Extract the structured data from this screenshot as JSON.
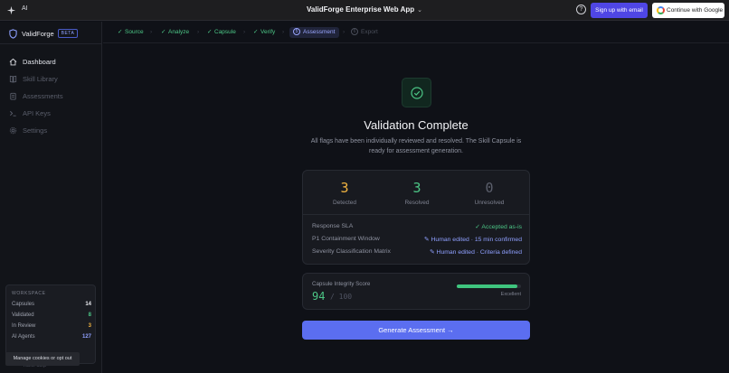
{
  "topbar": {
    "ai_label": "AI",
    "title": "ValidForge Enterprise Web App",
    "title_chevron": "⌄",
    "help_icon": "?",
    "signup_label": "Sign up with email",
    "google_label": "Continue with Google"
  },
  "sidebar": {
    "brand": "ValidForge",
    "badge": "BETA",
    "nav": [
      {
        "label": "Dashboard",
        "icon": "home-icon"
      },
      {
        "label": "Skill Library",
        "icon": "book-icon"
      },
      {
        "label": "Assessments",
        "icon": "clipboard-icon"
      },
      {
        "label": "API Keys",
        "icon": "terminal-icon"
      },
      {
        "label": "Settings",
        "icon": "gear-icon"
      }
    ],
    "workspace": {
      "title": "WORKSPACE",
      "rows": [
        {
          "label": "Capsules",
          "value": "14",
          "color": "#e8e9ee"
        },
        {
          "label": "Validated",
          "value": "8",
          "color": "#4cc686"
        },
        {
          "label": "In Review",
          "value": "3",
          "color": "#f0b341"
        },
        {
          "label": "AI Agents",
          "value": "127",
          "color": "#8fa0ff"
        }
      ]
    },
    "bottom_text": "Acme Corp"
  },
  "cookie_banner": "Manage cookies or opt out",
  "stepper": {
    "steps": [
      {
        "label": "Source",
        "state": "done"
      },
      {
        "label": "Analyze",
        "state": "done"
      },
      {
        "label": "Capsule",
        "state": "done"
      },
      {
        "label": "Verify",
        "state": "done"
      },
      {
        "label": "Assessment",
        "state": "current",
        "number": "5"
      },
      {
        "label": "Export",
        "state": "pending",
        "number": "6"
      }
    ],
    "separator": "›",
    "check": "✓"
  },
  "main": {
    "title": "Validation Complete",
    "subtitle_line1": "All flags have been individually reviewed and resolved. The Skill Capsule is",
    "subtitle_line2": "ready for assessment generation.",
    "stats": [
      {
        "value": "3",
        "label": "Detected",
        "color": "#f0b341"
      },
      {
        "value": "3",
        "label": "Resolved",
        "color": "#4cc686"
      },
      {
        "value": "0",
        "label": "Unresolved",
        "color": "#5b5f6c"
      }
    ],
    "flags": [
      {
        "label": "Response SLA",
        "value": "✓  Accepted as-is",
        "tone": "green"
      },
      {
        "label": "P1 Containment Window",
        "value": "✎  Human edited · 15 min confirmed",
        "tone": "blue"
      },
      {
        "label": "Severity Classification Matrix",
        "value": "✎  Human edited · Criteria defined",
        "tone": "blue"
      }
    ],
    "integrity": {
      "label": "Capsule Integrity Score",
      "score": "94",
      "of": "/  100",
      "level": 0.94,
      "rating": "Excellent"
    },
    "generate_label": "Generate Assessment  →"
  },
  "colors": {
    "accent": "#5b6ef0",
    "success": "#4cc686",
    "warning": "#f0b341"
  }
}
